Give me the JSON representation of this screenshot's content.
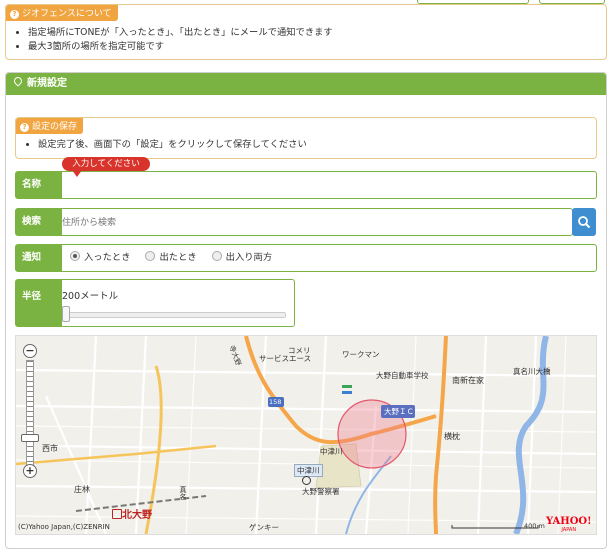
{
  "geofence_info": {
    "title": "ジオフェンスについて",
    "items": [
      "指定場所にTONEが「入ったとき」、「出たとき」にメールで通知できます",
      "最大3箇所の場所を指定可能です"
    ]
  },
  "new_settings": {
    "title": "新規設定",
    "save_info": {
      "title": "設定の保存",
      "items": [
        "設定完了後、画面下の「設定」をクリックして保存してください"
      ]
    },
    "name": {
      "label": "名称",
      "value": "",
      "tooltip": "入力してください"
    },
    "search": {
      "label": "検索",
      "placeholder": "住所から検索"
    },
    "notify": {
      "label": "通知",
      "options": [
        "入ったとき",
        "出たとき",
        "出入り両方"
      ],
      "selected": 0
    },
    "radius": {
      "label": "半径",
      "value_text": "200メートル",
      "slider_fraction": 0.0
    }
  },
  "map": {
    "labels": {
      "komeri": "コメリ",
      "service_ace": "サービスエース",
      "workman": "ワークマン",
      "school": "大野自動車学校",
      "nannshinzaike": "南新在家",
      "manao": "真名川大橋",
      "ic": "大野ＩＣ",
      "yokomakura": "横枕",
      "nishiichi": "西市",
      "nakatsugawa_road": "中津川",
      "nakatsugawa": "中津川",
      "police": "大野警察署",
      "shobayashi": "庄林",
      "station": "北大野",
      "kamimotomachi": "真名",
      "kyoto_road": "寺大野",
      "route158": "158",
      "genki": "ゲンキー",
      "copyright": "(C)Yahoo Japan,(C)ZENRIN",
      "scale": "400 m",
      "logo": "YAHOO!",
      "logo_sub": "JAPAN"
    }
  },
  "colors": {
    "accent": "#7ab342",
    "warn": "#f0a540",
    "search": "#3e8ed0",
    "tooltip": "#d9342b"
  }
}
